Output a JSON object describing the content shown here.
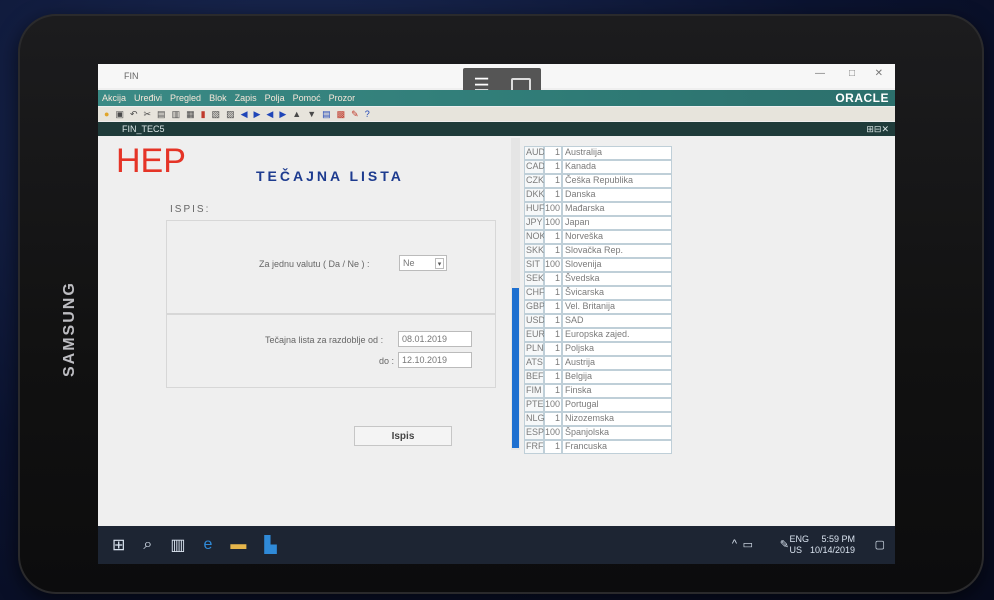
{
  "device": {
    "brand": "SAMSUNG"
  },
  "window": {
    "title": "FIN",
    "min": "—",
    "max": "□",
    "close": "✕"
  },
  "menubar": {
    "items": [
      "Akcija",
      "Uređivi",
      "Pregled",
      "Blok",
      "Zapis",
      "Polja",
      "Pomoć",
      "Prozor"
    ],
    "logo": "ORACLE"
  },
  "toolbar": {
    "help": "?"
  },
  "form": {
    "name": "FIN_TEC5",
    "controls": "⊞⊟✕"
  },
  "content": {
    "logo": "HEP",
    "title": "TEČAJNA LISTA",
    "section": "ISPIS:",
    "single_label": "Za jednu valutu ( Da / Ne ) :",
    "single_value": "Ne",
    "from_label": "Tečajna lista za razdoblje od :",
    "from_value": "08.01.2019",
    "to_label": "do :",
    "to_value": "12.10.2019",
    "button": "Ispis"
  },
  "currencies": [
    [
      "AUD",
      "1",
      "Australija"
    ],
    [
      "CAD",
      "1",
      "Kanada"
    ],
    [
      "CZK",
      "1",
      "Češka Republika"
    ],
    [
      "DKK",
      "1",
      "Danska"
    ],
    [
      "HUF",
      "100",
      "Mađarska"
    ],
    [
      "JPY",
      "100",
      "Japan"
    ],
    [
      "NOK",
      "1",
      "Norveška"
    ],
    [
      "SKK",
      "1",
      "Slovačka Rep."
    ],
    [
      "SIT",
      "100",
      "Slovenija"
    ],
    [
      "SEK",
      "1",
      "Švedska"
    ],
    [
      "CHF",
      "1",
      "Švicarska"
    ],
    [
      "GBP",
      "1",
      "Vel. Britanija"
    ],
    [
      "USD",
      "1",
      "SAD"
    ],
    [
      "EUR",
      "1",
      "Europska zajed."
    ],
    [
      "PLN",
      "1",
      "Poljska"
    ],
    [
      "ATS",
      "1",
      "Austrija"
    ],
    [
      "BEF",
      "1",
      "Belgija"
    ],
    [
      "FIM",
      "1",
      "Finska"
    ],
    [
      "PTE",
      "100",
      "Portugal"
    ],
    [
      "NLG",
      "1",
      "Nizozemska"
    ],
    [
      "ESP",
      "100",
      "Španjolska"
    ],
    [
      "FRF",
      "1",
      "Francuska"
    ]
  ],
  "taskbar": {
    "lang1": "ENG",
    "lang2": "US",
    "time": "5:59 PM",
    "date": "10/14/2019"
  }
}
